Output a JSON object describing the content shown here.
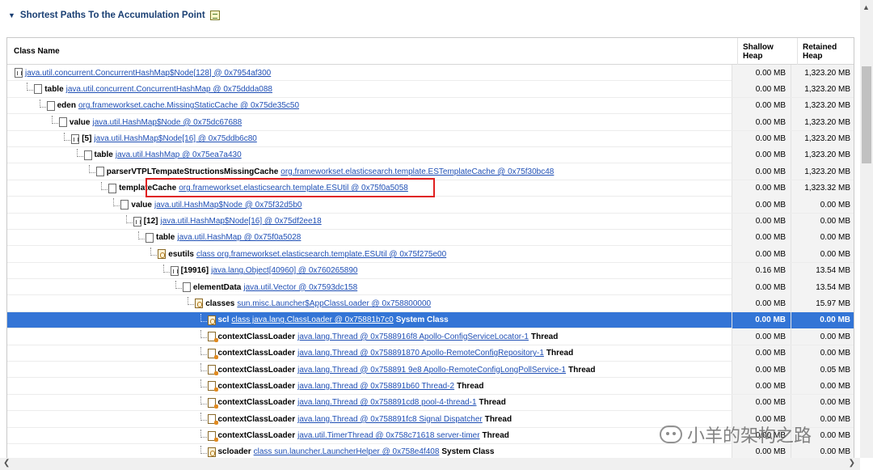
{
  "section": {
    "title": "Shortest Paths To the Accumulation Point",
    "toggle_icon": "triangle-down-icon",
    "export_icon": "spreadsheet-icon"
  },
  "columns": {
    "name": "Class Name",
    "shallow": "Shallow Heap",
    "retained": "Retained Heap"
  },
  "rows": [
    {
      "depth": 0,
      "icon": "arr",
      "field": "",
      "link": "java.util.concurrent.ConcurrentHashMap$Node[128] @ 0x7954af300",
      "suffix": "",
      "shallow": "0.00 MB",
      "retained": "1,323.20 MB"
    },
    {
      "depth": 1,
      "icon": "obj",
      "field": "table",
      "link": "java.util.concurrent.ConcurrentHashMap @ 0x75ddda088",
      "suffix": "",
      "shallow": "0.00 MB",
      "retained": "1,323.20 MB"
    },
    {
      "depth": 2,
      "icon": "obj",
      "field": "eden",
      "link": "org.frameworkset.cache.MissingStaticCache @ 0x75de35c50",
      "suffix": "",
      "shallow": "0.00 MB",
      "retained": "1,323.20 MB"
    },
    {
      "depth": 3,
      "icon": "obj",
      "field": "value",
      "link": "java.util.HashMap$Node @ 0x75dc67688",
      "suffix": "",
      "shallow": "0.00 MB",
      "retained": "1,323.20 MB"
    },
    {
      "depth": 4,
      "icon": "arr",
      "field": "[5]",
      "link": "java.util.HashMap$Node[16] @ 0x75ddb6c80",
      "suffix": "",
      "shallow": "0.00 MB",
      "retained": "1,323.20 MB"
    },
    {
      "depth": 5,
      "icon": "obj",
      "field": "table",
      "link": "java.util.HashMap @ 0x75ea7a430",
      "suffix": "",
      "shallow": "0.00 MB",
      "retained": "1,323.20 MB"
    },
    {
      "depth": 6,
      "icon": "obj",
      "field": "parserVTPLTempateStructionsMissingCache",
      "link": "org.frameworkset.elasticsearch.template.ESTemplateCache @ 0x75f30bc48",
      "suffix": "",
      "shallow": "0.00 MB",
      "retained": "1,323.20 MB"
    },
    {
      "depth": 7,
      "icon": "obj",
      "field": "templateCache",
      "link": "org.frameworkset.elasticsearch.template.ESUtil @ 0x75f0a5058",
      "suffix": "",
      "shallow": "0.00 MB",
      "retained": "1,323.32 MB"
    },
    {
      "depth": 8,
      "icon": "obj",
      "field": "value",
      "link": "java.util.HashMap$Node @ 0x75f32d5b0",
      "suffix": "",
      "shallow": "0.00 MB",
      "retained": "0.00 MB"
    },
    {
      "depth": 9,
      "icon": "arr",
      "field": "[12]",
      "link": "java.util.HashMap$Node[16] @ 0x75df2ee18",
      "suffix": "",
      "shallow": "0.00 MB",
      "retained": "0.00 MB"
    },
    {
      "depth": 10,
      "icon": "obj",
      "field": "table",
      "link": "java.util.HashMap @ 0x75f0a5028",
      "suffix": "",
      "shallow": "0.00 MB",
      "retained": "0.00 MB"
    },
    {
      "depth": 11,
      "icon": "cls",
      "field": "esutils",
      "link": "class org.frameworkset.elasticsearch.template.ESUtil @ 0x75f275e00",
      "suffix": "",
      "shallow": "0.00 MB",
      "retained": "0.00 MB"
    },
    {
      "depth": 12,
      "icon": "arr",
      "field": "[19916]",
      "link": "java.lang.Object[40960] @ 0x760265890",
      "suffix": "",
      "shallow": "0.16 MB",
      "retained": "13.54 MB"
    },
    {
      "depth": 13,
      "icon": "obj",
      "field": "elementData",
      "link": "java.util.Vector @ 0x7593dc158",
      "suffix": "",
      "shallow": "0.00 MB",
      "retained": "13.54 MB"
    },
    {
      "depth": 14,
      "icon": "cls",
      "field": "classes",
      "link": "sun.misc.Launcher$AppClassLoader @ 0x758800000",
      "suffix": "",
      "shallow": "0.00 MB",
      "retained": "15.97 MB"
    },
    {
      "depth": 15,
      "icon": "cls",
      "field": "scl",
      "link": "class java.lang.ClassLoader @ 0x75881b7c0",
      "suffix": "System Class",
      "shallow": "0.00 MB",
      "retained": "0.00 MB",
      "selected": true
    },
    {
      "depth": 15,
      "icon": "thr",
      "field": "contextClassLoader",
      "link": "java.lang.Thread @ 0x7588916f8 Apollo-ConfigServiceLocator-1",
      "suffix": "Thread",
      "shallow": "0.00 MB",
      "retained": "0.00 MB"
    },
    {
      "depth": 15,
      "icon": "thr",
      "field": "contextClassLoader",
      "link": "java.lang.Thread @ 0x758891870 Apollo-RemoteConfigRepository-1",
      "suffix": "Thread",
      "shallow": "0.00 MB",
      "retained": "0.00 MB"
    },
    {
      "depth": 15,
      "icon": "thr",
      "field": "contextClassLoader",
      "link": "java.lang.Thread @ 0x758891 9e8 Apollo-RemoteConfigLongPollService-1",
      "suffix": "Thread",
      "shallow": "0.00 MB",
      "retained": "0.05 MB"
    },
    {
      "depth": 15,
      "icon": "thr",
      "field": "contextClassLoader",
      "link": "java.lang.Thread @ 0x758891b60 Thread-2",
      "suffix": "Thread",
      "shallow": "0.00 MB",
      "retained": "0.00 MB"
    },
    {
      "depth": 15,
      "icon": "thr",
      "field": "contextClassLoader",
      "link": "java.lang.Thread @ 0x758891cd8 pool-4-thread-1",
      "suffix": "Thread",
      "shallow": "0.00 MB",
      "retained": "0.00 MB"
    },
    {
      "depth": 15,
      "icon": "thr",
      "field": "contextClassLoader",
      "link": "java.lang.Thread @ 0x758891fc8 Signal Dispatcher",
      "suffix": "Thread",
      "shallow": "0.00 MB",
      "retained": "0.00 MB"
    },
    {
      "depth": 15,
      "icon": "thr",
      "field": "contextClassLoader",
      "link": "java.util.TimerThread @ 0x758c71618 server-timer",
      "suffix": "Thread",
      "shallow": "0.00 MB",
      "retained": "0.00 MB"
    },
    {
      "depth": 15,
      "icon": "cls",
      "field": "scloader",
      "link": "class sun.launcher.LauncherHelper @ 0x758e4f408",
      "suffix": "System Class",
      "shallow": "0.00 MB",
      "retained": "0.00 MB"
    }
  ],
  "watermark": "小羊的架构之路",
  "colors": {
    "selected": "#3375d6",
    "link": "#1f4fb5",
    "highlight": "#e02020",
    "header": "#1a3f73"
  }
}
